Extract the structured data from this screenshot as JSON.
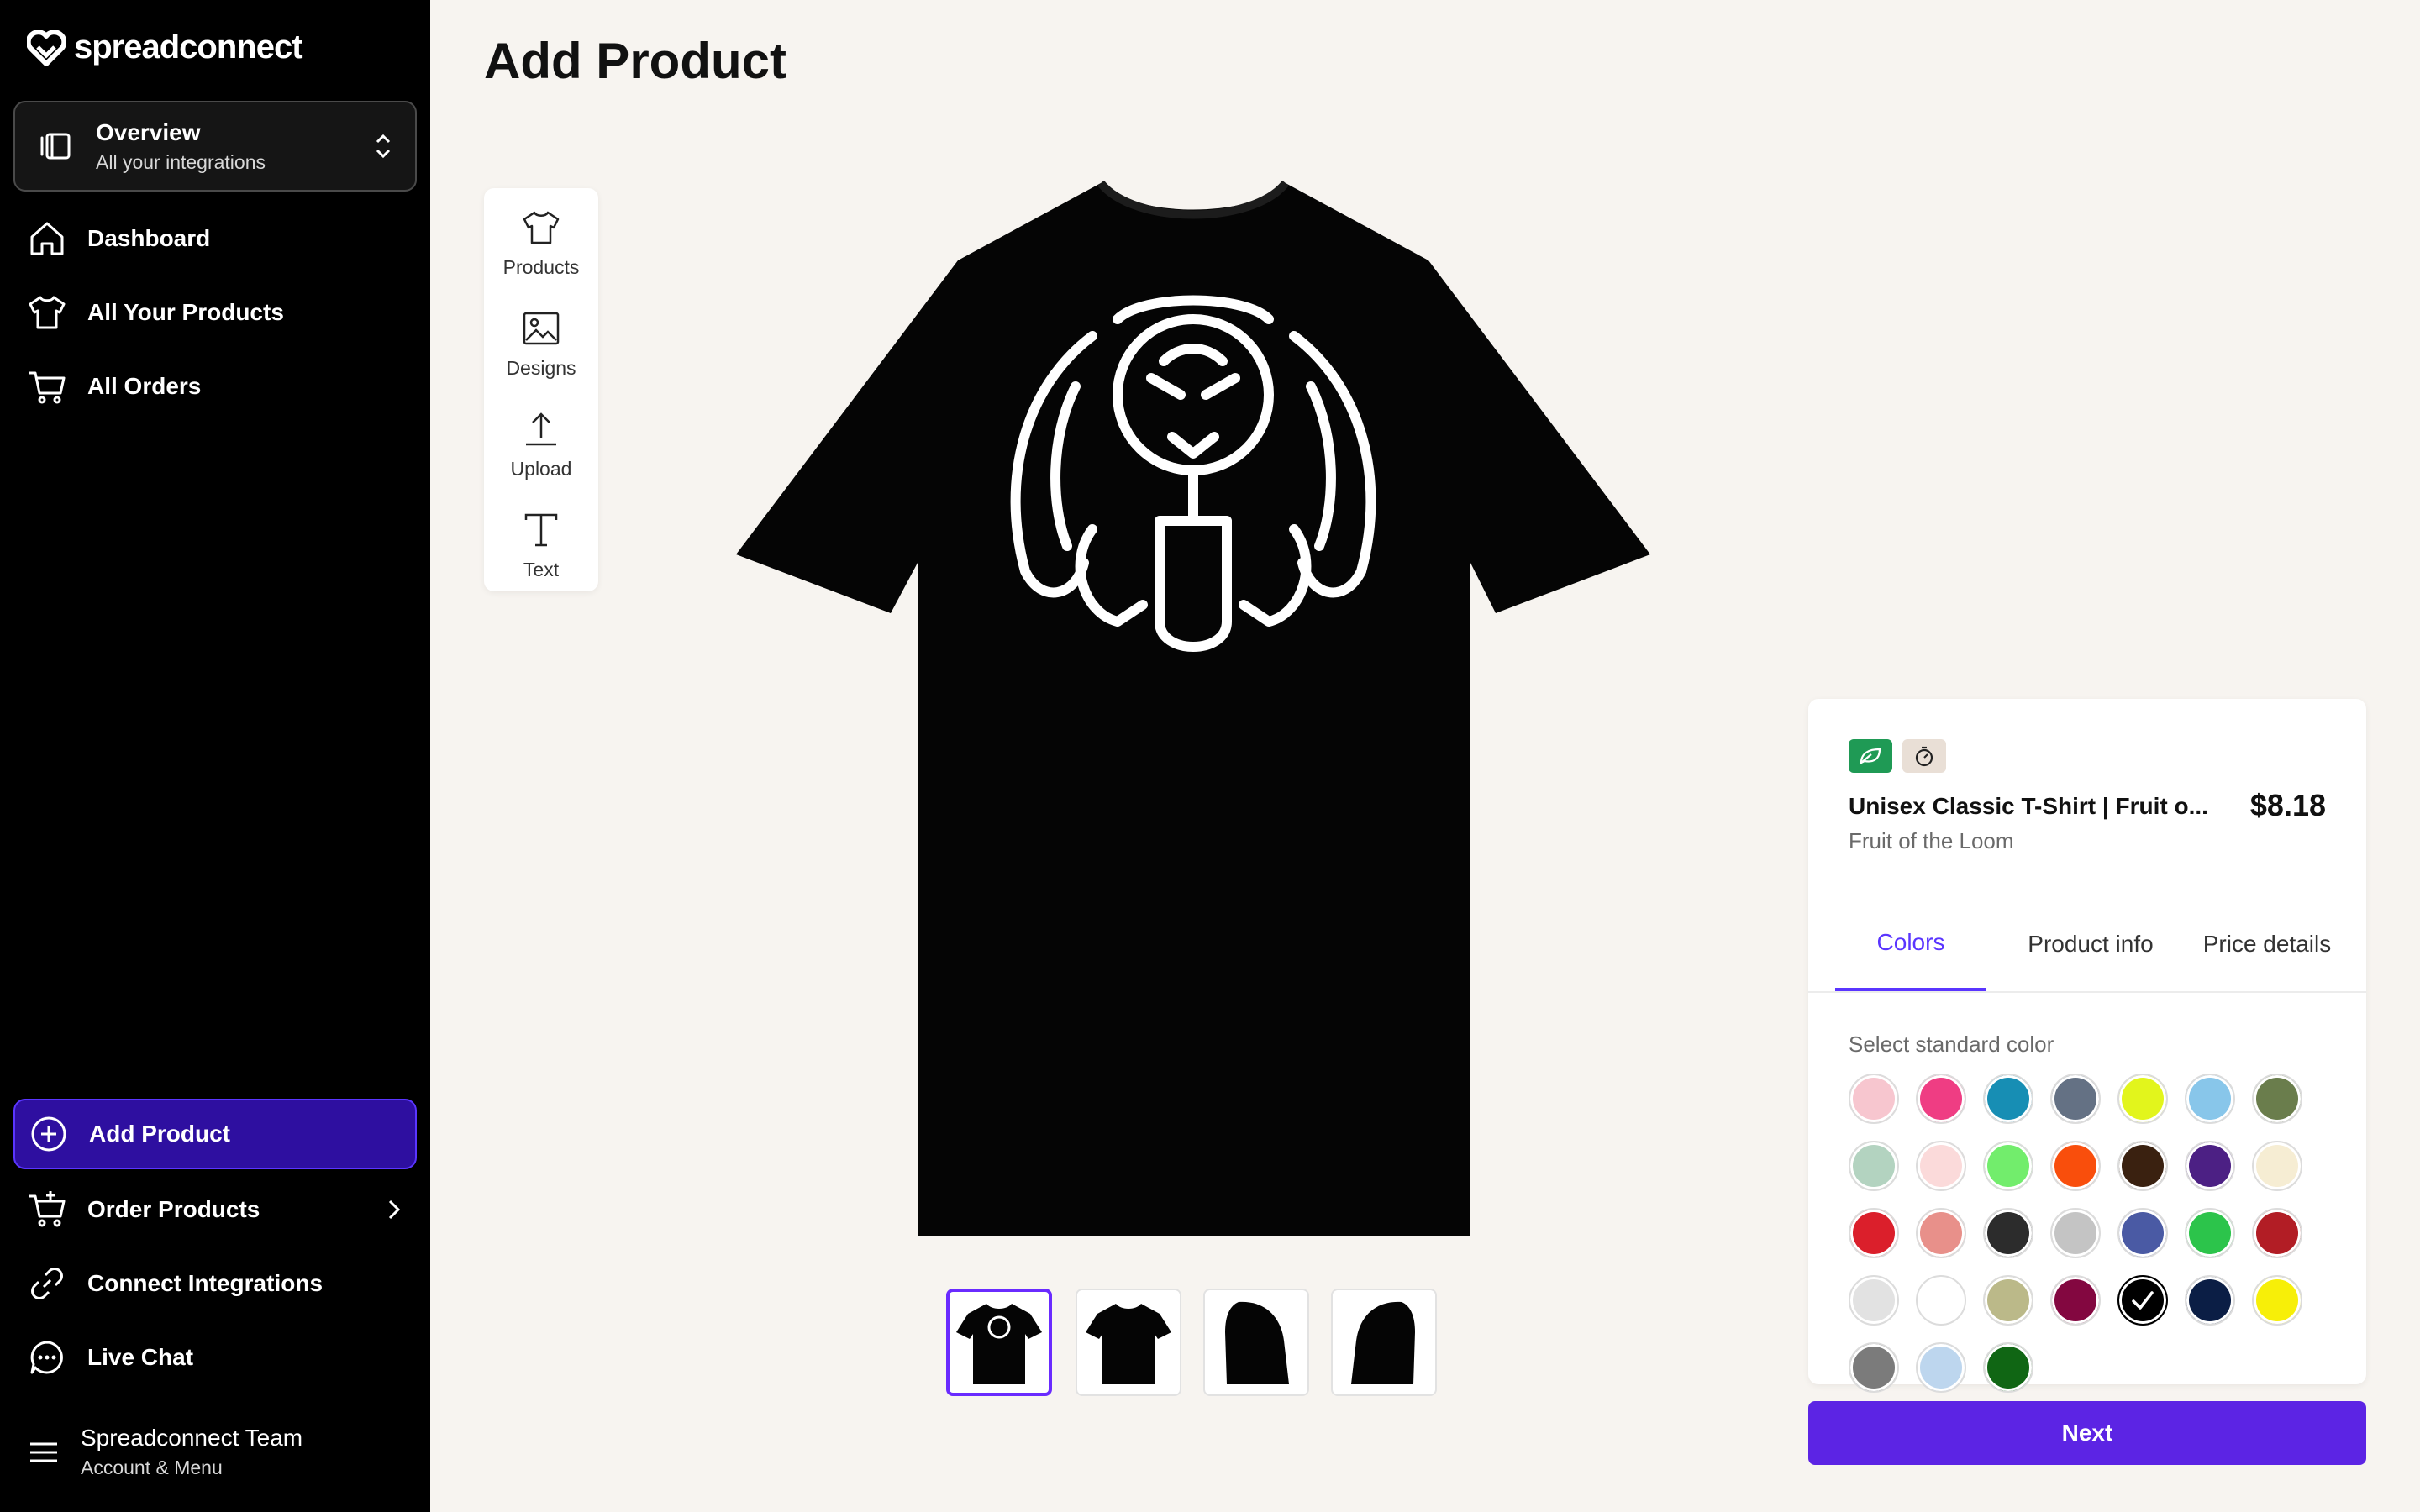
{
  "brand": {
    "logo_text": "spreadconnect"
  },
  "switcher": {
    "title": "Overview",
    "subtitle": "All your integrations"
  },
  "nav": {
    "top": [
      {
        "label": "Dashboard",
        "icon": "home-icon"
      },
      {
        "label": "All Your Products",
        "icon": "tshirt-icon"
      },
      {
        "label": "All Orders",
        "icon": "cart-icon"
      }
    ],
    "bottom": [
      {
        "label": "Add Product",
        "icon": "plus-circle-icon",
        "active": true
      },
      {
        "label": "Order Products",
        "icon": "cart-plus-icon"
      },
      {
        "label": "Connect Integrations",
        "icon": "link-icon"
      },
      {
        "label": "Live Chat",
        "icon": "chat-icon"
      }
    ]
  },
  "account": {
    "name": "Spreadconnect Team",
    "sub": "Account & Menu"
  },
  "page": {
    "title": "Add Product"
  },
  "tools": [
    {
      "label": "Products",
      "icon": "tshirt-icon"
    },
    {
      "label": "Designs",
      "icon": "image-icon"
    },
    {
      "label": "Upload",
      "icon": "upload-icon"
    },
    {
      "label": "Text",
      "icon": "text-icon"
    }
  ],
  "product": {
    "name": "Unisex Classic T-Shirt | Fruit o...",
    "brand": "Fruit of the Loom",
    "price": "$8.18"
  },
  "tabs": [
    "Colors",
    "Product info",
    "Price details"
  ],
  "active_tab": "Colors",
  "color_hint": "Select standard color",
  "colors": [
    "#f7c6cf",
    "#ef3d83",
    "#178eb4",
    "#647184",
    "#e2f51c",
    "#88c6ea",
    "#6a7d4c",
    "#b3d3c0",
    "#fbdada",
    "#72ed6c",
    "#f94e0c",
    "#3a2110",
    "#4c2084",
    "#f6edd3",
    "#db1f2b",
    "#e8908a",
    "#2c2c2c",
    "#c4c4c4",
    "#4a5aa4",
    "#2cc44b",
    "#b21d25",
    "#e2e2e2",
    "#ffffff",
    "#bbb989",
    "#830740",
    "#000000",
    "#0b1e45",
    "#f7ef08",
    "#7b7b7b",
    "#bdd6ee",
    "#106614"
  ],
  "selected_color": "#000000",
  "shirt_color": "#050505",
  "accent": "#5c24e4",
  "next_label": "Next"
}
